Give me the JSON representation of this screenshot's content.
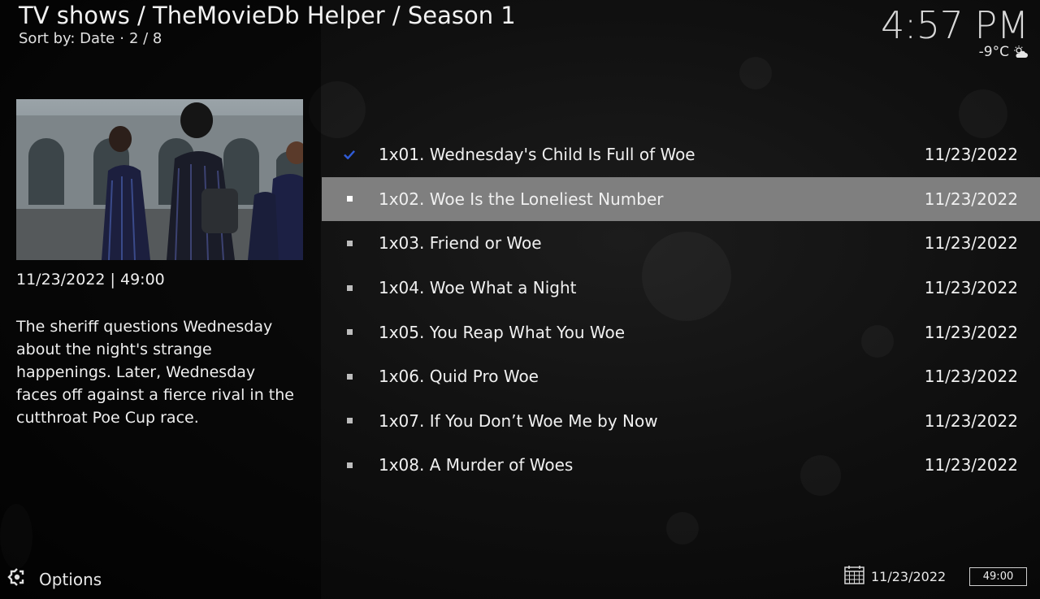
{
  "header": {
    "breadcrumb": "TV shows / TheMovieDb Helper / Season 1",
    "sort_label": "Sort by: Date",
    "separator": "·",
    "position": "2 / 8"
  },
  "clock": {
    "time": "4:57 PM",
    "temperature": "-9°C",
    "weather_icon": "partly-cloudy-icon"
  },
  "info": {
    "meta": "11/23/2022 | 49:00",
    "plot": "The sheriff questions Wednesday about the night's strange happenings. Later, Wednesday faces off against a fierce rival in the cutthroat Poe Cup race."
  },
  "episodes": [
    {
      "title": "1x01. Wednesday's Child Is Full of Woe",
      "date": "11/23/2022",
      "watched": true,
      "focused": false
    },
    {
      "title": "1x02. Woe Is the Loneliest Number",
      "date": "11/23/2022",
      "watched": false,
      "focused": true
    },
    {
      "title": "1x03. Friend or Woe",
      "date": "11/23/2022",
      "watched": false,
      "focused": false
    },
    {
      "title": "1x04. Woe What a Night",
      "date": "11/23/2022",
      "watched": false,
      "focused": false
    },
    {
      "title": "1x05. You Reap What You Woe",
      "date": "11/23/2022",
      "watched": false,
      "focused": false
    },
    {
      "title": "1x06. Quid Pro Woe",
      "date": "11/23/2022",
      "watched": false,
      "focused": false
    },
    {
      "title": "1x07. If You Don’t Woe Me by Now",
      "date": "11/23/2022",
      "watched": false,
      "focused": false
    },
    {
      "title": "1x08. A Murder of Woes",
      "date": "11/23/2022",
      "watched": false,
      "focused": false
    }
  ],
  "footer": {
    "options_label": "Options",
    "date": "11/23/2022",
    "runtime": "49:00"
  },
  "colors": {
    "watched_check": "#2f5bd6",
    "focus_bg": "#7f7f7f"
  }
}
